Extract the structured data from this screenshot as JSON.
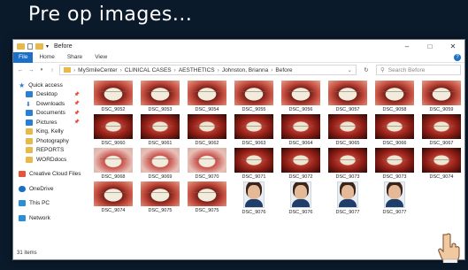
{
  "slide": {
    "title": "Pre op images..."
  },
  "window": {
    "title": "Before",
    "controls": {
      "minimize": "–",
      "maximize": "□",
      "close": "✕"
    }
  },
  "ribbon": {
    "file": "File",
    "tabs": [
      "Home",
      "Share",
      "View"
    ],
    "help": "?"
  },
  "address": {
    "crumbs": [
      "MySmileCenter",
      "CLINICAL CASES",
      "AESTHETICS",
      "Johnston, Brianna",
      "Before"
    ],
    "search_placeholder": "Search Before"
  },
  "sidebar": {
    "items": [
      {
        "label": "Quick access",
        "icon": "star-icon",
        "pinned": false
      },
      {
        "label": "Desktop",
        "icon": "desktop-icon",
        "pinned": true
      },
      {
        "label": "Downloads",
        "icon": "download-icon",
        "pinned": true
      },
      {
        "label": "Documents",
        "icon": "documents-icon",
        "pinned": true
      },
      {
        "label": "Pictures",
        "icon": "pictures-icon",
        "pinned": true
      },
      {
        "label": "King, Kelly",
        "icon": "folder-icon",
        "pinned": false
      },
      {
        "label": "Photography",
        "icon": "folder-icon",
        "pinned": false
      },
      {
        "label": "REPORTS",
        "icon": "folder-icon",
        "pinned": false
      },
      {
        "label": "WORDdocs",
        "icon": "folder-icon",
        "pinned": false
      },
      {
        "label": "Creative Cloud Files",
        "icon": "creative-cloud-icon",
        "pinned": false
      },
      {
        "label": "OneDrive",
        "icon": "onedrive-icon",
        "pinned": false
      },
      {
        "label": "This PC",
        "icon": "computer-icon",
        "pinned": false
      },
      {
        "label": "Network",
        "icon": "network-icon",
        "pinned": false
      }
    ]
  },
  "files": [
    {
      "name": "DSC_9052",
      "kind": "smile"
    },
    {
      "name": "DSC_9053",
      "kind": "smile"
    },
    {
      "name": "DSC_9054",
      "kind": "smile"
    },
    {
      "name": "DSC_9055",
      "kind": "smile"
    },
    {
      "name": "DSC_9056",
      "kind": "smile"
    },
    {
      "name": "DSC_9057",
      "kind": "smile"
    },
    {
      "name": "DSC_9058",
      "kind": "smile"
    },
    {
      "name": "DSC_9059",
      "kind": "smile"
    },
    {
      "name": "DSC_9060",
      "kind": "retract"
    },
    {
      "name": "DSC_9061",
      "kind": "retract"
    },
    {
      "name": "DSC_9062",
      "kind": "retract"
    },
    {
      "name": "DSC_9063",
      "kind": "retract"
    },
    {
      "name": "DSC_9064",
      "kind": "retract"
    },
    {
      "name": "DSC_9065",
      "kind": "retract"
    },
    {
      "name": "DSC_9066",
      "kind": "retract"
    },
    {
      "name": "DSC_9067",
      "kind": "retract"
    },
    {
      "name": "DSC_9068",
      "kind": "occl"
    },
    {
      "name": "DSC_9069",
      "kind": "occl"
    },
    {
      "name": "DSC_9070",
      "kind": "occl"
    },
    {
      "name": "DSC_9071",
      "kind": "retract"
    },
    {
      "name": "DSC_9072",
      "kind": "retract"
    },
    {
      "name": "DSC_9073",
      "kind": "retract"
    },
    {
      "name": "DSC_9073",
      "kind": "retract"
    },
    {
      "name": "DSC_9074",
      "kind": "retract"
    },
    {
      "name": "DSC_9074",
      "kind": "smile"
    },
    {
      "name": "DSC_9075",
      "kind": "smile"
    },
    {
      "name": "DSC_9075",
      "kind": "smile"
    },
    {
      "name": "DSC_9076",
      "kind": "portrait"
    },
    {
      "name": "DSC_9076",
      "kind": "portrait"
    },
    {
      "name": "DSC_9077",
      "kind": "portrait"
    },
    {
      "name": "DSC_9077",
      "kind": "portrait"
    }
  ],
  "status": {
    "count": "31 items"
  }
}
